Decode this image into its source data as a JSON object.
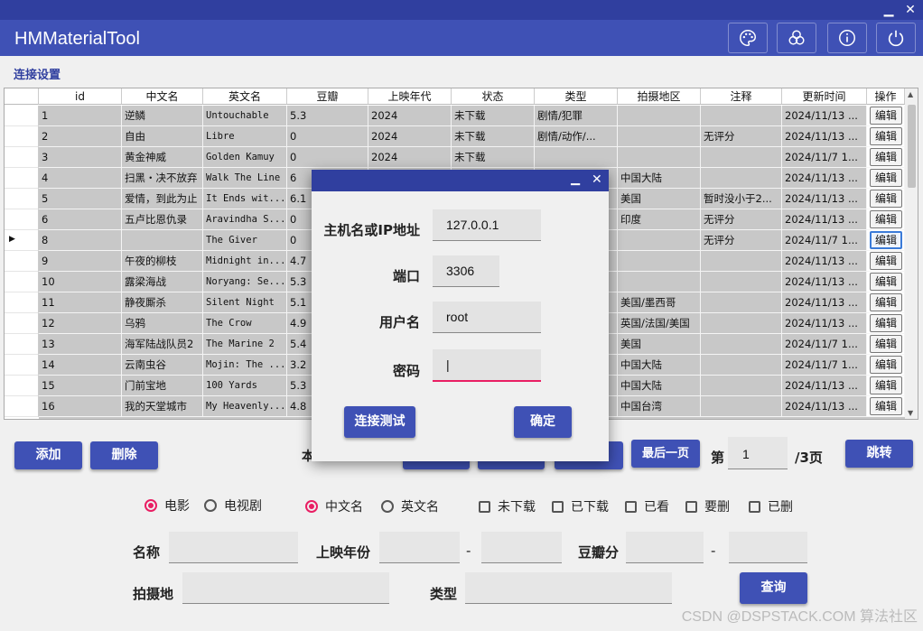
{
  "window": {
    "minimize": "▁",
    "close": "✕"
  },
  "app": {
    "title": "HMMaterialTool"
  },
  "toolbar_icons": [
    "palette-icon",
    "theme-circles-icon",
    "info-icon",
    "power-icon"
  ],
  "section_title": "连接设置",
  "table": {
    "columns": [
      "id",
      "中文名",
      "英文名",
      "豆瓣",
      "上映年代",
      "状态",
      "类型",
      "拍摄地区",
      "注释",
      "更新时间",
      "操作"
    ],
    "rows": [
      [
        "1",
        "逆鳞",
        "Untouchable",
        "5.3",
        "2024",
        "未下载",
        "剧情/犯罪",
        "",
        "",
        "2024/11/13 ...",
        "编辑"
      ],
      [
        "2",
        "自由",
        "Libre",
        "0",
        "2024",
        "未下载",
        "剧情/动作/...",
        "",
        "无评分",
        "2024/11/13 ...",
        "编辑"
      ],
      [
        "3",
        "黄金神威",
        "Golden Kamuy",
        "0",
        "2024",
        "未下载",
        "",
        "",
        "",
        "2024/11/7 1...",
        "编辑"
      ],
      [
        "4",
        "扫黑・决不放弃",
        "Walk The Line",
        "6",
        "",
        "",
        "",
        "中国大陆",
        "",
        "2024/11/13 ...",
        "编辑"
      ],
      [
        "5",
        "爱情，到此为止",
        "It Ends wit...",
        "6.1",
        "",
        "",
        "",
        "美国",
        "暂时没小于2...",
        "2024/11/13 ...",
        "编辑"
      ],
      [
        "6",
        "五卢比恩仇录",
        "Aravindha S...",
        "0",
        "",
        "",
        "情",
        "印度",
        "无评分",
        "2024/11/13 ...",
        "编辑"
      ],
      [
        "8",
        "",
        "The Giver",
        "0",
        "",
        "",
        "",
        "",
        "无评分",
        "2024/11/7 1...",
        "编辑"
      ],
      [
        "9",
        "午夜的柳枝",
        "Midnight in...",
        "4.7",
        "",
        "",
        "",
        "",
        "",
        "2024/11/13 ...",
        "编辑"
      ],
      [
        "10",
        "露梁海战",
        "Noryang: Se...",
        "5.3",
        "",
        "",
        "",
        "",
        "",
        "2024/11/13 ...",
        "编辑"
      ],
      [
        "11",
        "静夜厮杀",
        "Silent Night",
        "5.1",
        "",
        "",
        "",
        "美国/墨西哥",
        "",
        "2024/11/13 ...",
        "编辑"
      ],
      [
        "12",
        "乌鸦",
        "The Crow",
        "4.9",
        "",
        "",
        "",
        "英国/法国/美国",
        "",
        "2024/11/13 ...",
        "编辑"
      ],
      [
        "13",
        "海军陆战队员2",
        "The Marine 2",
        "5.4",
        "",
        "",
        "康",
        "美国",
        "",
        "2024/11/7 1...",
        "编辑"
      ],
      [
        "14",
        "云南虫谷",
        "Mojin: The ...",
        "3.2",
        "",
        "",
        "险",
        "中国大陆",
        "",
        "2024/11/7 1...",
        "编辑"
      ],
      [
        "15",
        "门前宝地",
        "100 Yards",
        "5.3",
        "",
        "",
        "侠",
        "中国大陆",
        "",
        "2024/11/13 ...",
        "编辑"
      ],
      [
        "16",
        "我的天堂城市",
        "My Heavenly...",
        "4.8",
        "",
        "",
        "",
        "中国台湾",
        "",
        "2024/11/13 ...",
        "编辑"
      ]
    ]
  },
  "pager": {
    "add": "添加",
    "delete": "删除",
    "page_prefix": "本",
    "last_page": "最后一页",
    "page_label": "第",
    "page_value": "1",
    "page_total": "/3页",
    "jump": "跳转"
  },
  "filters": {
    "media": [
      "电影",
      "电视剧"
    ],
    "lang": [
      "中文名",
      "英文名"
    ],
    "status": [
      "未下载",
      "已下载",
      "已看",
      "要删",
      "已删"
    ],
    "name": "名称",
    "year": "上映年份",
    "dash": "-",
    "douban": "豆瓣分",
    "region": "拍摄地",
    "genre": "类型",
    "query": "查询"
  },
  "dialog": {
    "host_label": "主机名或IP地址",
    "host_value": "127.0.0.1",
    "port_label": "端口",
    "port_value": "3306",
    "user_label": "用户名",
    "user_value": "root",
    "pwd_label": "密码",
    "pwd_value": "|",
    "test": "连接测试",
    "ok": "确定",
    "minimize": "▁",
    "close": "✕"
  },
  "watermark": "CSDN @DSPSTACK.COM 算法社区",
  "colors": {
    "primary": "#3f51b5",
    "primary_dark": "#303f9f",
    "accent": "#e91e63"
  }
}
